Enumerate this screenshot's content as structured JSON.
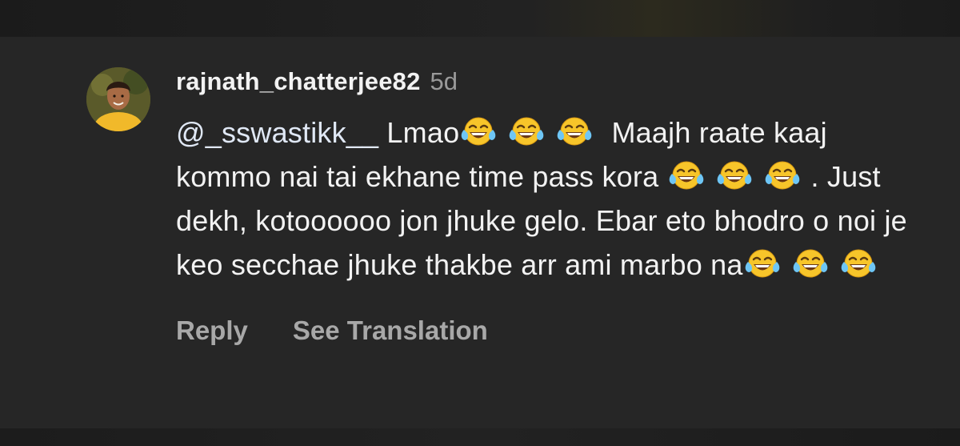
{
  "comment": {
    "username": "rajnath_chatterjee82",
    "time": "5d",
    "mention": "@_sswastikk__",
    "text_part1": " Lmao",
    "text_part2": " Maajh raate kaaj kommo nai tai ekhane time pass kora ",
    "text_part3": ". Just dekh, kotoooooo jon jhuke gelo. Ebar eto bhodro o noi je keo secchae jhuke thakbe arr ami marbo na",
    "emoji_icon": "face-with-tears-of-joy-icon"
  },
  "actions": {
    "reply_label": "Reply",
    "translate_label": "See Translation"
  },
  "colors": {
    "background": "#262626",
    "text": "#f2f2f2",
    "secondary_text": "#a8a8a8",
    "emoji_yellow": "#f7c52a",
    "tear_blue": "#6ec6f5"
  }
}
